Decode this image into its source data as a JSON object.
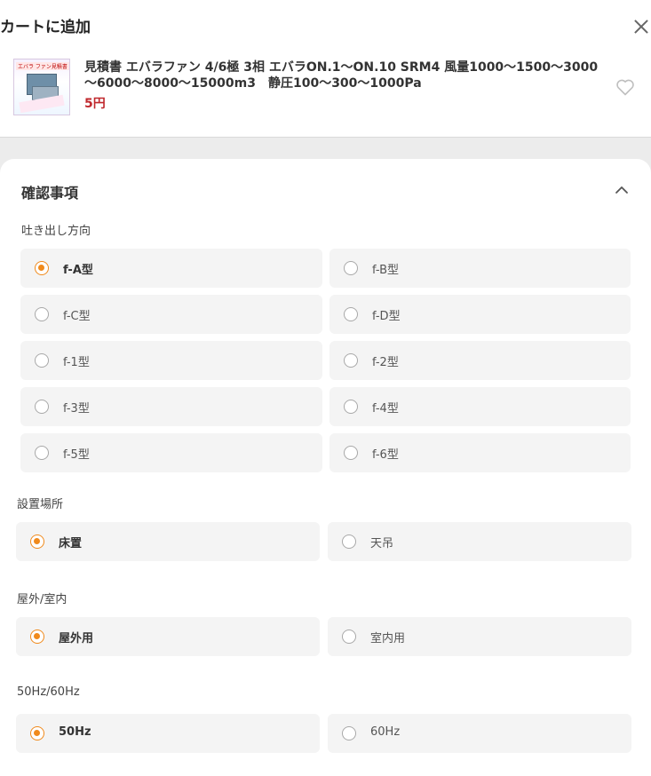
{
  "header": {
    "title": "カートに追加",
    "product": {
      "name": "見積書 エバラファン 4/6極 3相 エバラON.1～ON.10 SRM4 風量1000～1500～3000～6000～8000～15000m3　静圧100～300～1000Pa",
      "price": "5円",
      "thumbnail_label": "エバラ ファン見積書"
    }
  },
  "confirm": {
    "title": "確認事項",
    "groups": [
      {
        "label": "吐き出し方向",
        "options": [
          "f-A型",
          "f-B型",
          "f-C型",
          "f-D型",
          "f-1型",
          "f-2型",
          "f-3型",
          "f-4型",
          "f-5型",
          "f-6型"
        ],
        "selected": "f-A型"
      },
      {
        "label": "設置場所",
        "options": [
          "床置",
          "天吊"
        ],
        "selected": "床置"
      },
      {
        "label": "屋外/室内",
        "options": [
          "屋外用",
          "室内用"
        ],
        "selected": "屋外用"
      },
      {
        "label": "50Hz/60Hz",
        "options": [
          "50Hz",
          "60Hz"
        ],
        "selected": "50Hz"
      }
    ]
  },
  "colors": {
    "accent": "#f08a1c",
    "price": "#c0282d",
    "option_bg": "#f4f4f4"
  },
  "icons": [
    "close-icon",
    "heart-icon",
    "chevron-up-icon",
    "radio-icon"
  ]
}
